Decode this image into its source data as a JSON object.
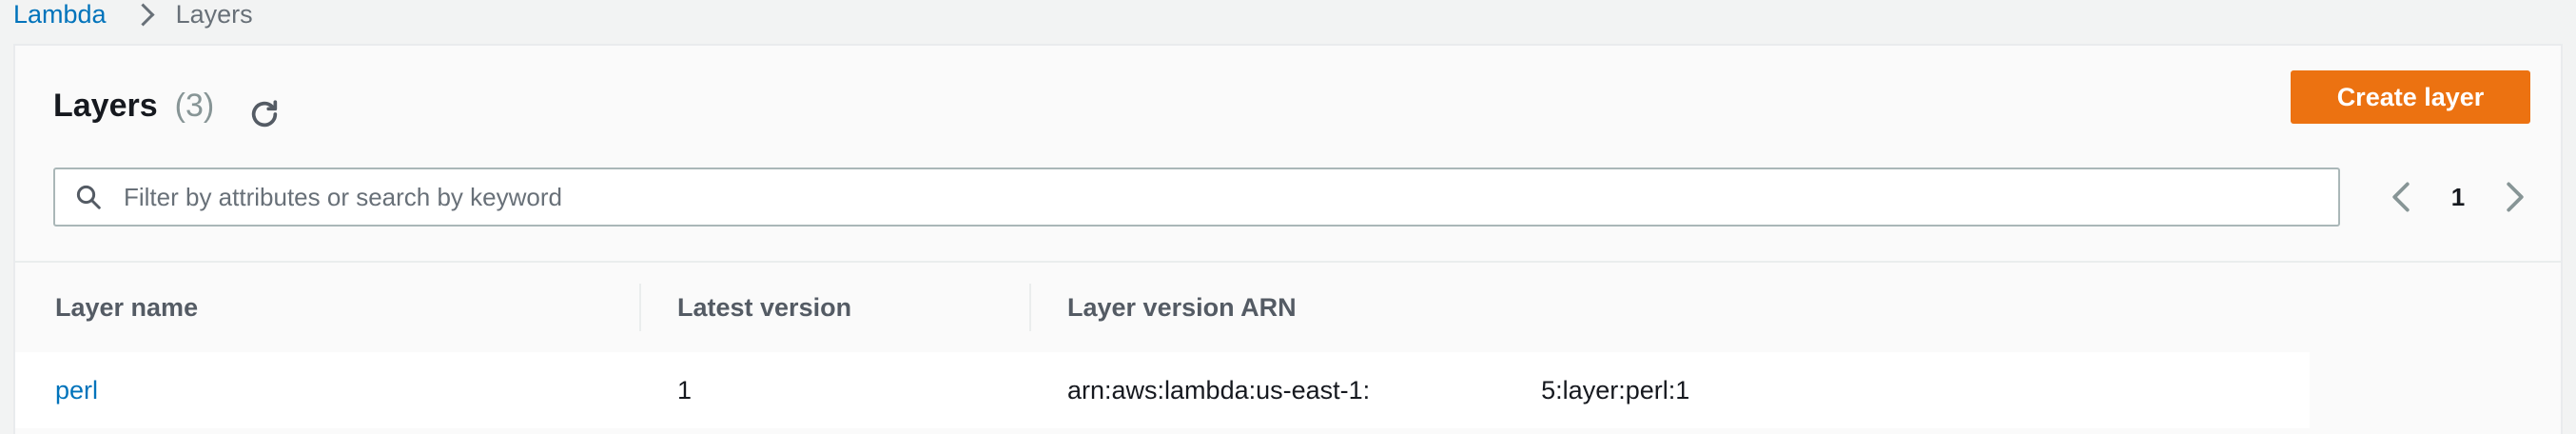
{
  "breadcrumb": {
    "root": "Lambda",
    "current": "Layers"
  },
  "header": {
    "title": "Layers",
    "count": "(3)",
    "refresh_icon": "refresh-icon",
    "create_label": "Create layer"
  },
  "search": {
    "placeholder": "Filter by attributes or search by keyword",
    "value": "",
    "icon": "search-icon"
  },
  "pagination": {
    "current_page": "1",
    "prev_icon": "chevron-left-icon",
    "next_icon": "chevron-right-icon"
  },
  "table": {
    "columns": [
      "Layer name",
      "Latest version",
      "Layer version ARN"
    ],
    "rows": [
      {
        "name": "perl",
        "latest_version": "1",
        "arn_prefix": "arn:aws:lambda:us-east-1:",
        "arn_suffix": "5:layer:perl:1"
      }
    ]
  },
  "colors": {
    "accent": "#ec7211",
    "link": "#0073bb",
    "background": "#f2f3f3"
  }
}
